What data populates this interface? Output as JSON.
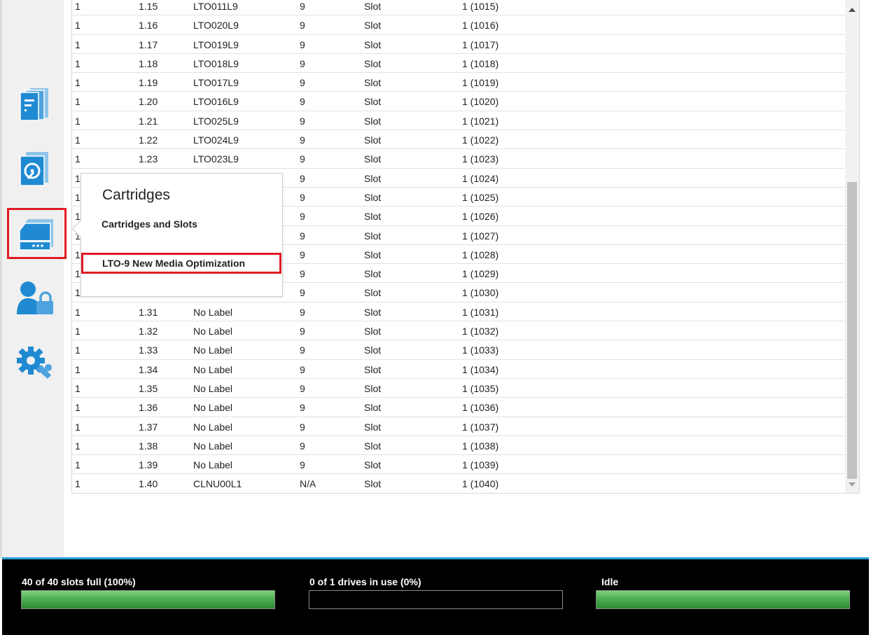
{
  "sidebar": {
    "items": [
      {
        "name": "library",
        "icon": "library-icon"
      },
      {
        "name": "drives",
        "icon": "drive-icon"
      },
      {
        "name": "cartridges",
        "icon": "cartridge-icon",
        "active": true
      },
      {
        "name": "users",
        "icon": "user-lock-icon"
      },
      {
        "name": "configuration",
        "icon": "gear-wrench-icon"
      }
    ],
    "accent_color": "#1f8ad2",
    "highlight_color": "#e01b24"
  },
  "table": {
    "rows": [
      [
        "1",
        "1.15",
        "LTO011L9",
        "9",
        "Slot",
        "1 (1015)"
      ],
      [
        "1",
        "1.16",
        "LTO020L9",
        "9",
        "Slot",
        "1 (1016)"
      ],
      [
        "1",
        "1.17",
        "LTO019L9",
        "9",
        "Slot",
        "1 (1017)"
      ],
      [
        "1",
        "1.18",
        "LTO018L9",
        "9",
        "Slot",
        "1 (1018)"
      ],
      [
        "1",
        "1.19",
        "LTO017L9",
        "9",
        "Slot",
        "1 (1019)"
      ],
      [
        "1",
        "1.20",
        "LTO016L9",
        "9",
        "Slot",
        "1 (1020)"
      ],
      [
        "1",
        "1.21",
        "LTO025L9",
        "9",
        "Slot",
        "1 (1021)"
      ],
      [
        "1",
        "1.22",
        "LTO024L9",
        "9",
        "Slot",
        "1 (1022)"
      ],
      [
        "1",
        "1.23",
        "LTO023L9",
        "9",
        "Slot",
        "1 (1023)"
      ],
      [
        "1",
        "",
        "",
        "9",
        "Slot",
        "1 (1024)"
      ],
      [
        "1",
        "",
        "",
        "9",
        "Slot",
        "1 (1025)"
      ],
      [
        "1",
        "",
        "",
        "9",
        "Slot",
        "1 (1026)"
      ],
      [
        "1",
        "",
        "",
        "9",
        "Slot",
        "1 (1027)"
      ],
      [
        "1",
        "",
        "",
        "9",
        "Slot",
        "1 (1028)"
      ],
      [
        "1",
        "",
        "",
        "9",
        "Slot",
        "1 (1029)"
      ],
      [
        "1",
        "",
        "",
        "9",
        "Slot",
        "1 (1030)"
      ],
      [
        "1",
        "1.31",
        "No Label",
        "9",
        "Slot",
        "1 (1031)"
      ],
      [
        "1",
        "1.32",
        "No Label",
        "9",
        "Slot",
        "1 (1032)"
      ],
      [
        "1",
        "1.33",
        "No Label",
        "9",
        "Slot",
        "1 (1033)"
      ],
      [
        "1",
        "1.34",
        "No Label",
        "9",
        "Slot",
        "1 (1034)"
      ],
      [
        "1",
        "1.35",
        "No Label",
        "9",
        "Slot",
        "1 (1035)"
      ],
      [
        "1",
        "1.36",
        "No Label",
        "9",
        "Slot",
        "1 (1036)"
      ],
      [
        "1",
        "1.37",
        "No Label",
        "9",
        "Slot",
        "1 (1037)"
      ],
      [
        "1",
        "1.38",
        "No Label",
        "9",
        "Slot",
        "1 (1038)"
      ],
      [
        "1",
        "1.39",
        "No Label",
        "9",
        "Slot",
        "1 (1039)"
      ],
      [
        "1",
        "1.40",
        "CLNU00L1",
        "N/A",
        "Slot",
        "1 (1040)"
      ]
    ]
  },
  "popup": {
    "title": "Cartridges",
    "items": [
      "Cartridges and Slots",
      "LTO-9 New Media Optimization"
    ]
  },
  "status": {
    "slots": {
      "label": "40 of 40 slots full (100%)",
      "fill_fraction": 1.0
    },
    "drives": {
      "label": "0 of 1 drives in use (0%)",
      "fill_fraction": 0.0
    },
    "activity": {
      "label": "Idle",
      "fill_fraction": 1.0
    }
  }
}
